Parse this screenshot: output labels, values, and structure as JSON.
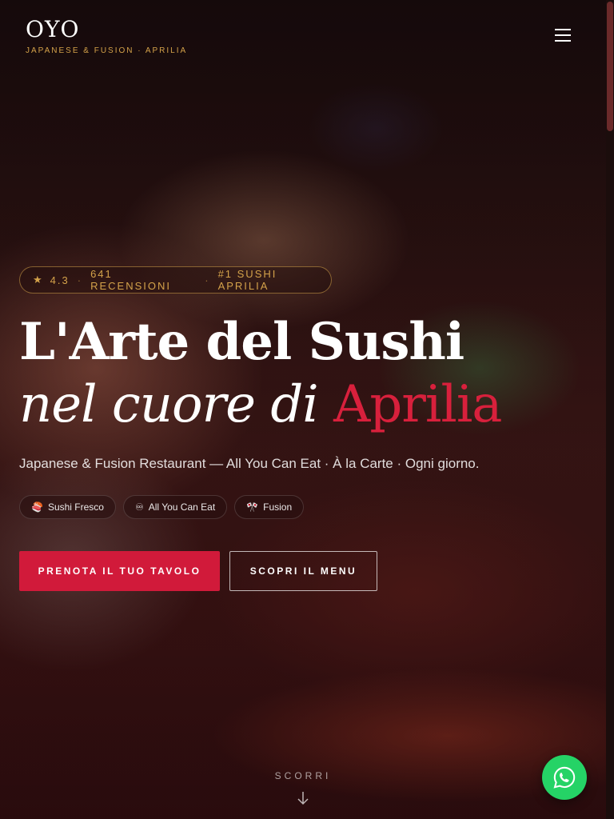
{
  "header": {
    "brand_name": "OYO",
    "tagline": "JAPANESE & FUSION · APRILIA",
    "menu_icon": "hamburger-menu-icon"
  },
  "hero": {
    "rating_badge": {
      "star": "★",
      "rating": "4.3",
      "reviews": "641 RECENSIONI",
      "rank": "#1 SUSHI APRILIA",
      "separator": "·"
    },
    "headline_line1": "L'Arte del Sushi",
    "headline_line2_prefix": "nel cuore di ",
    "headline_line2_accent": "Aprilia",
    "subheadline": "Japanese & Fusion Restaurant — All You Can Eat · À la Carte · Ogni giorno.",
    "chips": [
      {
        "icon": "🍣",
        "label": "Sushi Fresco"
      },
      {
        "icon": "♾",
        "label": "All You Can Eat"
      },
      {
        "icon": "🎌",
        "label": "Fusion"
      }
    ],
    "primary_cta": "PRENOTA IL TUO TAVOLO",
    "secondary_cta": "SCOPRI IL MENU",
    "scroll_hint": "SCORRI"
  },
  "colors": {
    "accent_red": "#d11a3a",
    "gold": "#d4a24a",
    "whatsapp_green": "#25d366"
  },
  "floating": {
    "whatsapp_icon": "whatsapp-icon"
  }
}
